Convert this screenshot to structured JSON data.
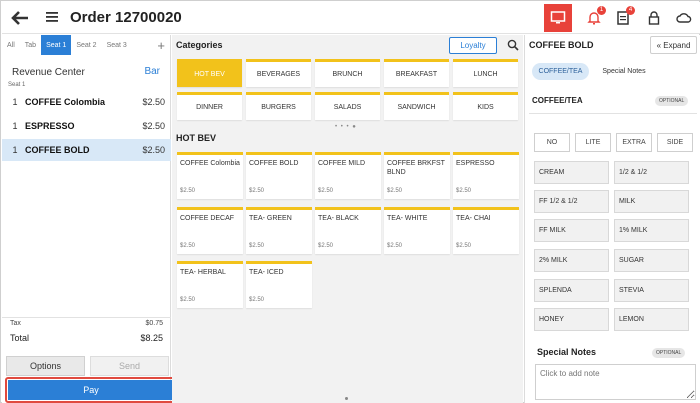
{
  "header": {
    "order_title": "Order 12700020",
    "notification_count": "1",
    "docs_count": "4"
  },
  "left": {
    "seat_tabs": [
      "All",
      "Tab",
      "Seat 1",
      "Seat 2",
      "Seat 3"
    ],
    "active_seat_tab": "Seat 1",
    "add_seat": "+",
    "revenue_center_label": "Revenue Center",
    "revenue_center_value": "Bar",
    "seat_label": "Seat 1",
    "items": [
      {
        "qty": "1",
        "name": "COFFEE Colombia",
        "price": "$2.50"
      },
      {
        "qty": "1",
        "name": "ESPRESSO",
        "price": "$2.50"
      },
      {
        "qty": "1",
        "name": "COFFEE BOLD",
        "price": "$2.50"
      }
    ],
    "tax_label": "Tax",
    "tax_value": "$0.75",
    "total_label": "Total",
    "total_value": "$8.25",
    "options_label": "Options",
    "send_label": "Send",
    "pay_label": "Pay"
  },
  "middle": {
    "categories_heading": "Categories",
    "loyalty_label": "Loyalty",
    "categories": [
      "HOT BEV",
      "BEVERAGES",
      "BRUNCH",
      "BREAKFAST",
      "LUNCH",
      "DINNER",
      "BURGERS",
      "SALADS",
      "SANDWICH",
      "KIDS"
    ],
    "pager_dots": "• • • ●",
    "group_heading": "HOT BEV",
    "products": [
      {
        "name": "COFFEE Colombia",
        "price": "$2.50"
      },
      {
        "name": "COFFEE BOLD",
        "price": "$2.50"
      },
      {
        "name": "COFFEE MILD",
        "price": "$2.50"
      },
      {
        "name": "COFFEE BRKFST BLND",
        "price": "$2.50"
      },
      {
        "name": "ESPRESSO",
        "price": "$2.50"
      },
      {
        "name": "COFFEE DECAF",
        "price": "$2.50"
      },
      {
        "name": "TEA- GREEN",
        "price": "$2.50"
      },
      {
        "name": "TEA- BLACK",
        "price": "$2.50"
      },
      {
        "name": "TEA- WHITE",
        "price": "$2.50"
      },
      {
        "name": "TEA- CHAI",
        "price": "$2.50"
      },
      {
        "name": "TEA- HERBAL",
        "price": "$2.50"
      },
      {
        "name": "TEA- ICED",
        "price": "$2.50"
      }
    ]
  },
  "right": {
    "title": "COFFEE BOLD",
    "expand_label": "« Expand",
    "tabs": [
      "COFFEE/TEA",
      "Special Notes"
    ],
    "section_title": "COFFEE/TEA",
    "optional_badge": "OPTIONAL",
    "level_options": [
      "NO",
      "LITE",
      "EXTRA",
      "SIDE"
    ],
    "modifiers": [
      "CREAM",
      "1/2 & 1/2",
      "FF 1/2 & 1/2",
      "MILK",
      "FF MILK",
      "1% MILK",
      "2% MILK",
      "SUGAR",
      "SPLENDA",
      "STEVIA",
      "HONEY",
      "LEMON"
    ],
    "notes_heading": "Special Notes",
    "notes_optional": "OPTIONAL",
    "notes_placeholder": "Click to add note"
  },
  "colors": {
    "accent_blue": "#2b7fd6",
    "category_yellow": "#f2c21b",
    "alert_red": "#e8423a"
  },
  "icons": [
    "back-arrow-icon",
    "hamburger-menu-icon",
    "display-icon",
    "bell-icon",
    "document-icon",
    "lock-icon",
    "cloud-icon",
    "search-icon"
  ]
}
